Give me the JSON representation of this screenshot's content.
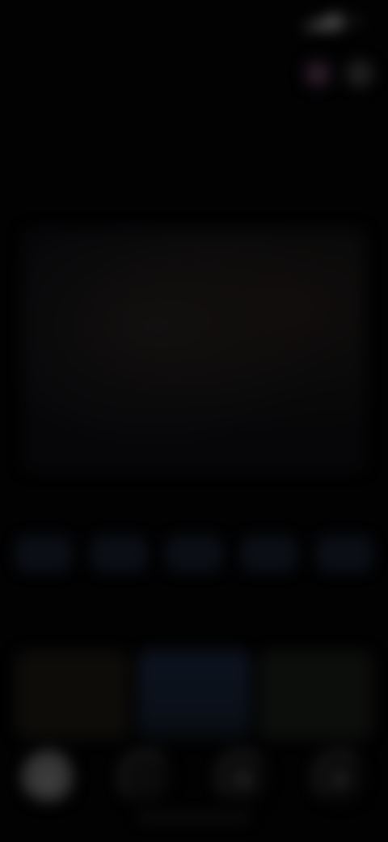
{
  "status_bar": {
    "time": "",
    "icons": []
  },
  "header": {
    "title": "",
    "action_icons": [
      "avatar-icon",
      "menu-icon"
    ]
  },
  "subtitle": "",
  "featured": {
    "line1": "",
    "line2": ""
  },
  "hero": {
    "caption": ""
  },
  "chips": [
    "",
    "",
    "",
    "",
    ""
  ],
  "cards": [
    "",
    "",
    ""
  ],
  "bottom_nav": {
    "items": [
      "home-icon",
      "search-icon",
      "library-icon",
      "profile-icon"
    ]
  }
}
